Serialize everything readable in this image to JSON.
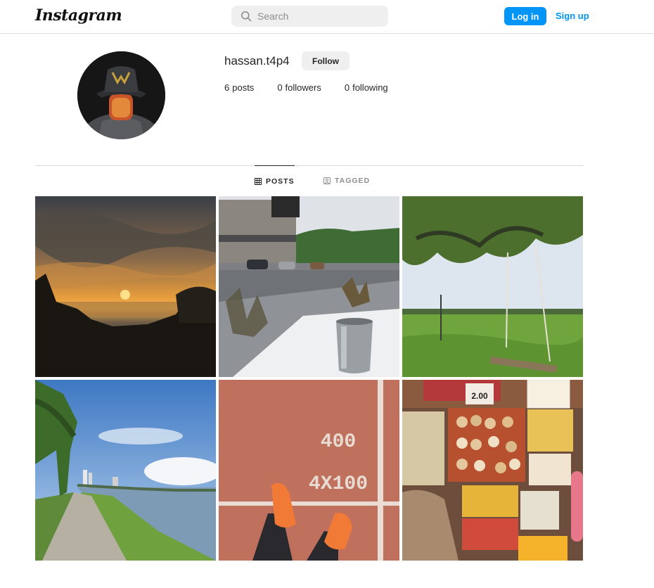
{
  "header": {
    "logo_text": "Instagram",
    "search_placeholder": "Search",
    "login_label": "Log in",
    "signup_label": "Sign up"
  },
  "profile": {
    "username": "hassan.t4p4",
    "follow_label": "Follow",
    "posts_count": "6",
    "posts_label": "posts",
    "followers_count": "0",
    "followers_label": "followers",
    "following_count": "0",
    "following_label": "following"
  },
  "tabs": [
    {
      "label": "POSTS",
      "icon": "grid-icon",
      "active": true
    },
    {
      "label": "TAGGED",
      "icon": "tagged-icon",
      "active": false
    }
  ],
  "posts": [
    {
      "subject": "sunset over the sea"
    },
    {
      "subject": "rainy street with a steel cup"
    },
    {
      "subject": "tree with a rope swing over a field"
    },
    {
      "subject": "seaside path with palm trees"
    },
    {
      "subject": "running track with orange shoes",
      "track_text_1": "400",
      "track_text_2": "4X100"
    },
    {
      "subject": "market stall with snacks",
      "price_text": "2.00"
    }
  ],
  "colors": {
    "accent": "#0095f6",
    "border": "#dbdbdb",
    "muted_text": "#8e8e8e",
    "button_grey": "#efefef"
  }
}
